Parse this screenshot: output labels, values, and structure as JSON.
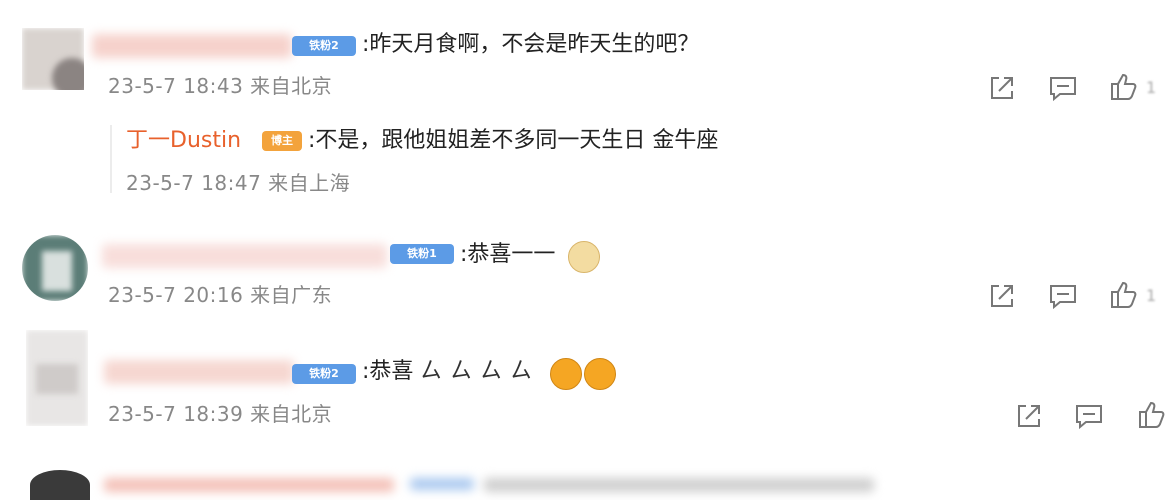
{
  "comments": [
    {
      "badge": "铁粉2",
      "text": ":昨天月食啊，不会是昨天生的吧？",
      "meta": "23-5-7 18:43 来自北京",
      "likes": "1",
      "reply": {
        "name": "丁一Dustin",
        "badge": "博主",
        "text": ":不是，跟他姐姐差不多同一天生日 金牛座",
        "meta": "23-5-7 18:47 来自上海"
      }
    },
    {
      "badge": "铁粉1",
      "text": ":恭喜一一",
      "meta": "23-5-7 20:16 来自广东",
      "likes": "1"
    },
    {
      "badge": "铁粉2",
      "text": ":恭喜",
      "meta": "23-5-7 18:39 来自北京",
      "extra_symbols": "ㄙㄙㄙㄙ"
    }
  ],
  "icons": [
    "share-icon",
    "comment-icon",
    "like-icon"
  ],
  "colors": {
    "reply_name": "#e8612c",
    "badge_blue": "#5c9be6",
    "badge_host": "#f3a33c",
    "meta_text": "#888888"
  }
}
